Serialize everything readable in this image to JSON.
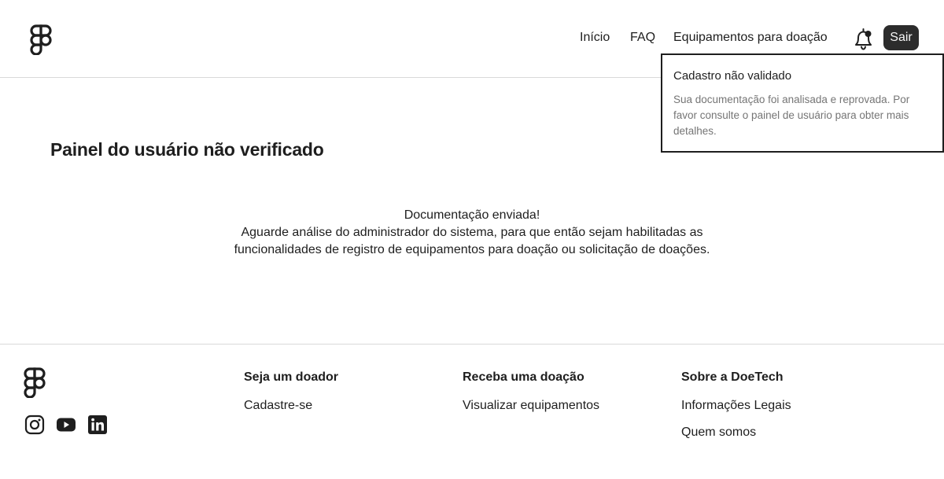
{
  "header": {
    "logo_icon": "figma-logo-icon",
    "nav": [
      {
        "label": "Início"
      },
      {
        "label": "FAQ"
      },
      {
        "label": "Equipamentos para doação"
      }
    ],
    "notification_icon": "bell-icon",
    "logout_label": "Sair"
  },
  "notification": {
    "title": "Cadastro não validado",
    "body": "Sua documentação foi analisada e reprovada. Por favor consulte o painel de usuário para obter mais detalhes."
  },
  "main": {
    "title": "Painel do usuário não verificado",
    "message_lines": [
      "Documentação enviada!",
      "Aguarde análise do administrador do sistema, para que então sejam habilitadas as",
      "funcionalidades de registro de equipamentos para doação ou solicitação de doações."
    ]
  },
  "footer": {
    "logo_icon": "figma-logo-icon",
    "social_icons": [
      "instagram-icon",
      "youtube-icon",
      "linkedin-icon"
    ],
    "columns": [
      {
        "heading": "Seja um doador",
        "links": [
          "Cadastre-se"
        ]
      },
      {
        "heading": "Receba uma doação",
        "links": [
          "Visualizar equipamentos"
        ]
      },
      {
        "heading": "Sobre a DoeTech",
        "links": [
          "Informações Legais",
          "Quem somos"
        ]
      }
    ]
  },
  "colors": {
    "text": "#1e1e1e",
    "muted": "#757575",
    "button_bg": "#2c2c2c",
    "divider": "#d9d9d9"
  }
}
